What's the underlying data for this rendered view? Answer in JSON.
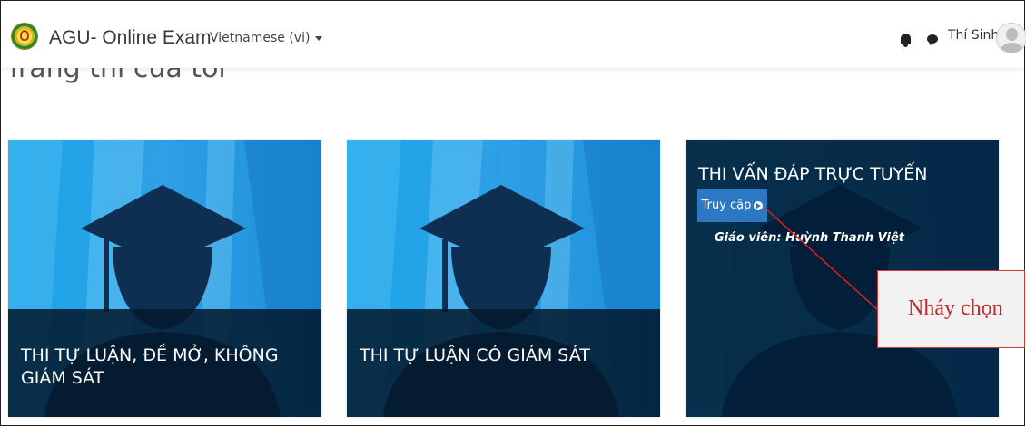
{
  "page_heading": "Trang thi của tôi",
  "navbar": {
    "site_name": "AGU- Online Exam",
    "language": "Vietnamese ‎(vi)‎",
    "user_name": "Thí Sinh"
  },
  "cards": [
    {
      "title": "THI TỰ LUẬN, ĐỀ MỞ, KHÔNG GIÁM SÁT"
    },
    {
      "title": "THI TỰ LUẬN CÓ GIÁM SÁT"
    },
    {
      "title": "THI VẤN ĐÁP TRỰC TUYẾN",
      "button_label": "Truy cập",
      "teacher": "Giáo viên: Huỳnh Thanh Việt"
    }
  ],
  "callout": {
    "text": "Nháy chọn"
  },
  "colors": {
    "accent": "#2b78c4",
    "callout_border": "#d23a3a",
    "callout_text": "#c6262a",
    "overlay": "#02182d"
  }
}
